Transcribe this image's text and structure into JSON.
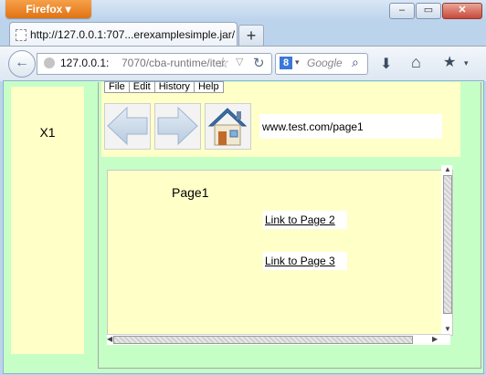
{
  "browser": {
    "menu_button": "Firefox ▾",
    "window_controls": [
      "–",
      "▭",
      "✕"
    ],
    "tab": {
      "title": "http://127.0.0.1:707...erexamplesimple.jar/"
    },
    "new_tab": "+",
    "url": {
      "host": "127.0.0.1:",
      "rest": "7070/cba-runtime/iter"
    },
    "search": {
      "placeholder": "Google"
    }
  },
  "app": {
    "left_panel_label": "X1",
    "menu": [
      "File",
      "Edit",
      "History",
      "Help"
    ],
    "address": "www.test.com/page1",
    "page": {
      "title": "Page1",
      "links": [
        "Link to Page 2",
        "Link to Page 3"
      ]
    }
  }
}
